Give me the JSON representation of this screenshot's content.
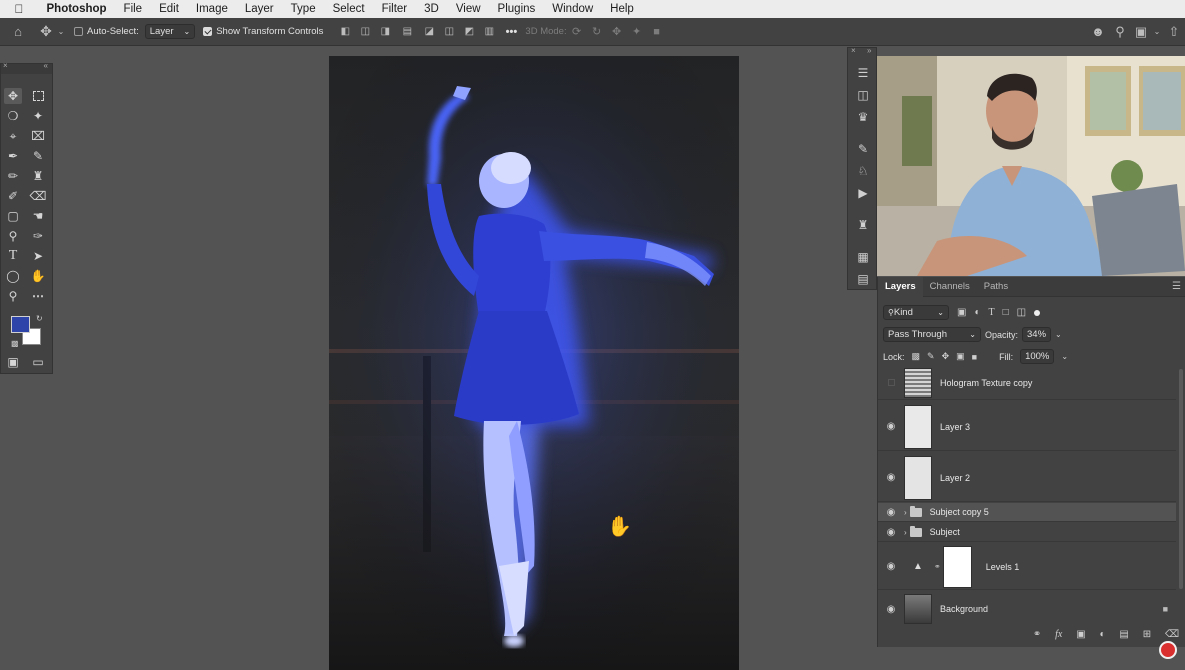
{
  "menubar": {
    "app_name": "Photoshop",
    "items": [
      "File",
      "Edit",
      "Image",
      "Layer",
      "Type",
      "Select",
      "Filter",
      "3D",
      "View",
      "Plugins",
      "Window",
      "Help"
    ]
  },
  "options_bar": {
    "auto_select_label": "Auto-Select:",
    "auto_select_checked": false,
    "auto_select_target": "Layer",
    "show_transform_label": "Show Transform Controls",
    "show_transform_checked": true,
    "mode_3d_label": "3D Mode:",
    "more_label": "•••"
  },
  "toolbar": {
    "foreground_color": "#2f44a8",
    "background_color": "#ffffff"
  },
  "layers_panel": {
    "tabs": [
      "Layers",
      "Channels",
      "Paths"
    ],
    "active_tab": "Layers",
    "filter_kind": "Kind",
    "blend_mode": "Pass Through",
    "opacity_label": "Opacity:",
    "opacity_value": "34%",
    "lock_label": "Lock:",
    "fill_label": "Fill:",
    "fill_value": "100%",
    "layers": [
      {
        "name": "Hologram Texture copy",
        "visible": false,
        "type": "pixel"
      },
      {
        "name": "Layer 3",
        "visible": true,
        "type": "pixel"
      },
      {
        "name": "Layer 2",
        "visible": true,
        "type": "pixel"
      },
      {
        "name": "Subject copy 5",
        "visible": true,
        "type": "group",
        "selected": true
      },
      {
        "name": "Subject",
        "visible": true,
        "type": "group"
      },
      {
        "name": "Levels 1",
        "visible": true,
        "type": "adjustment"
      },
      {
        "name": "Background",
        "visible": true,
        "type": "pixel",
        "locked": true
      }
    ]
  },
  "colors": {
    "hologram_blue": "#3b4fd8",
    "panel_bg": "#424242",
    "pasteboard": "#535353"
  }
}
